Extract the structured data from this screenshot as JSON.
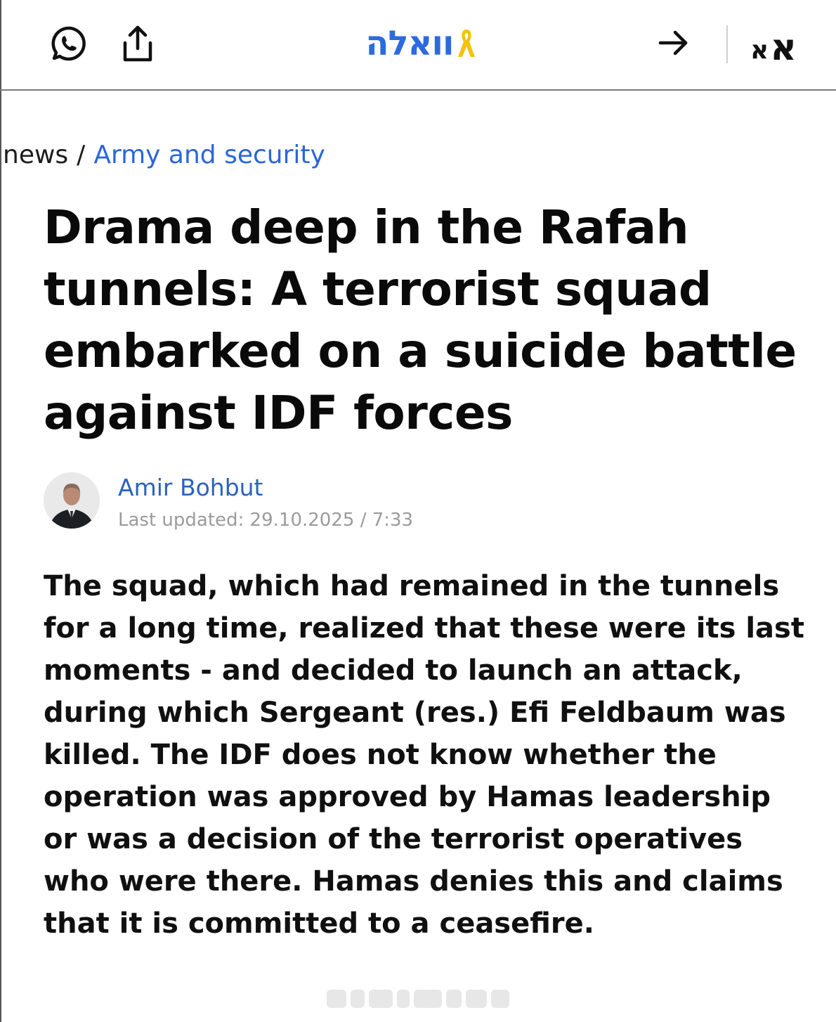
{
  "header": {
    "logo_text": "וואלה",
    "font_size_small": "א",
    "font_size_large": "א",
    "icons": {
      "whatsapp": "whatsapp-icon",
      "share": "share-icon",
      "back": "arrow-right-icon",
      "ribbon": "yellow-ribbon-icon"
    },
    "brand_color": "#2d6ae0",
    "ribbon_color": "#f4c20d"
  },
  "breadcrumb": {
    "home": "news",
    "separator": "/",
    "section": "Army and security"
  },
  "article": {
    "title": "Drama deep in the Rafah tunnels: A terrorist squad embarked on a suicide battle against IDF forces",
    "author": "Amir Bohbut",
    "updated": "Last updated: 29.10.2025 / 7:33",
    "lead": "The squad, which had remained in the tunnels for a long time, realized that these were its last moments - and decided to launch an attack, during which Sergeant (res.) Efi Feldbaum was killed. The IDF does not know whether the operation was approved by Hamas leadership or was a decision of the terrorist operatives who were there. Hamas denies this and claims that it is committed to a ceasefire."
  },
  "colors": {
    "link": "#2b66d9",
    "author": "#2b62bf",
    "meta": "#9b9b9b"
  }
}
